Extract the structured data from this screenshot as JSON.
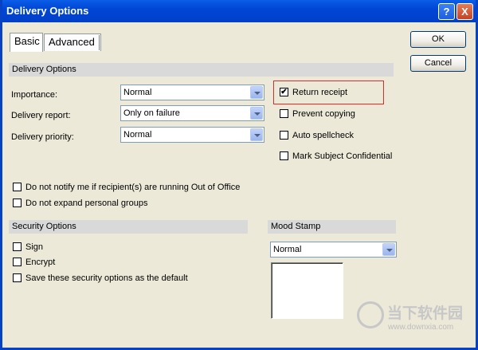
{
  "window": {
    "title": "Delivery Options",
    "help_label": "?",
    "close_label": "X"
  },
  "tabs": [
    {
      "label": "Basic"
    },
    {
      "label": "Advanced"
    }
  ],
  "buttons": {
    "ok": "OK",
    "cancel": "Cancel"
  },
  "delivery": {
    "section_title": "Delivery Options",
    "importance": {
      "label": "Importance:",
      "value": "Normal"
    },
    "report": {
      "label": "Delivery report:",
      "value": "Only on failure"
    },
    "priority": {
      "label": "Delivery priority:",
      "value": "Normal"
    }
  },
  "checks": {
    "return_receipt": {
      "label": "Return receipt",
      "checked": true,
      "mark": "✔"
    },
    "prevent_copying": {
      "label": "Prevent copying",
      "checked": false
    },
    "auto_spellcheck": {
      "label": "Auto spellcheck",
      "checked": false
    },
    "mark_confidential": {
      "label": "Mark Subject Confidential",
      "checked": false
    },
    "no_out_of_office": {
      "label": "Do not notify me if recipient(s) are running Out of Office",
      "checked": false
    },
    "no_expand_groups": {
      "label": "Do not expand personal groups",
      "checked": false
    }
  },
  "security": {
    "section_title": "Security Options",
    "sign": {
      "label": "Sign",
      "checked": false
    },
    "encrypt": {
      "label": "Encrypt",
      "checked": false
    },
    "save_default": {
      "label": "Save these security options as the default",
      "checked": false
    }
  },
  "mood": {
    "section_title": "Mood Stamp",
    "value": "Normal"
  },
  "watermark": {
    "text": "当下软件园",
    "url": "www.downxia.com"
  },
  "colors": {
    "titlebar": "#0046d5",
    "highlight": "#e62727",
    "section": "#d9d9d9"
  }
}
